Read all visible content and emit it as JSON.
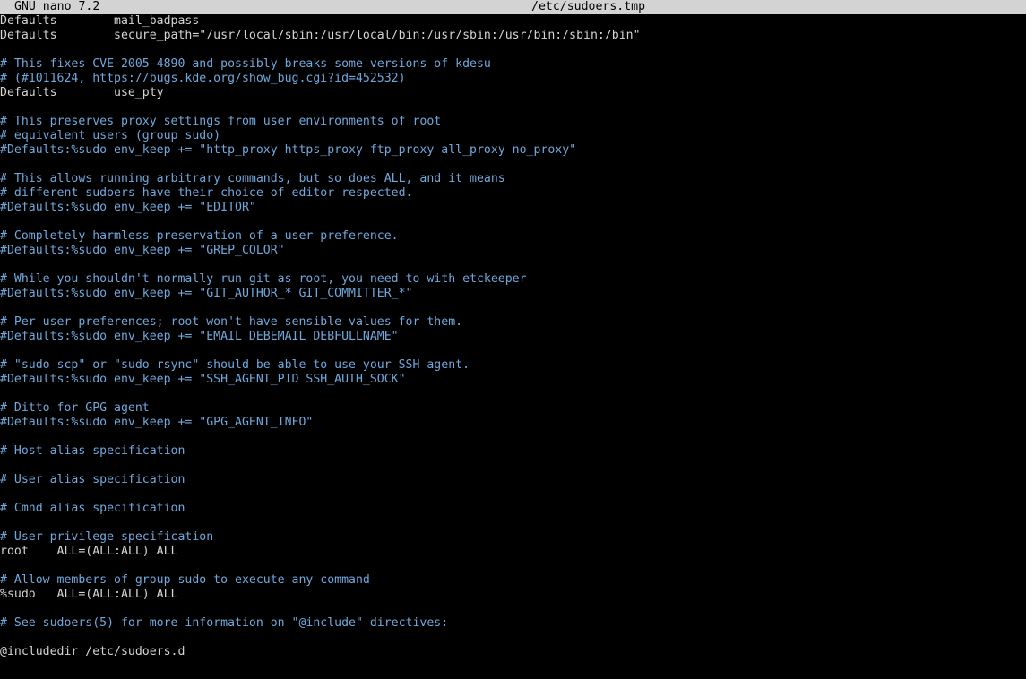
{
  "titlebar": {
    "app_name": "GNU nano 7.2",
    "file_name": "/etc/sudoers.tmp"
  },
  "colors": {
    "background": "#000000",
    "text": "#d3d3d3",
    "comment": "#6fa8dc",
    "titlebar_bg": "#d3d3d3"
  },
  "lines": [
    {
      "text": "Defaults        mail_badpass",
      "kind": "text"
    },
    {
      "text": "Defaults        secure_path=\"/usr/local/sbin:/usr/local/bin:/usr/sbin:/usr/bin:/sbin:/bin\"",
      "kind": "text"
    },
    {
      "text": "",
      "kind": "text"
    },
    {
      "text": "# This fixes CVE-2005-4890 and possibly breaks some versions of kdesu",
      "kind": "comment"
    },
    {
      "text": "# (#1011624, https://bugs.kde.org/show_bug.cgi?id=452532)",
      "kind": "comment"
    },
    {
      "text": "Defaults        use_pty",
      "kind": "text"
    },
    {
      "text": "",
      "kind": "text"
    },
    {
      "text": "# This preserves proxy settings from user environments of root",
      "kind": "comment"
    },
    {
      "text": "# equivalent users (group sudo)",
      "kind": "comment"
    },
    {
      "text": "#Defaults:%sudo env_keep += \"http_proxy https_proxy ftp_proxy all_proxy no_proxy\"",
      "kind": "comment"
    },
    {
      "text": "",
      "kind": "text"
    },
    {
      "text": "# This allows running arbitrary commands, but so does ALL, and it means",
      "kind": "comment"
    },
    {
      "text": "# different sudoers have their choice of editor respected.",
      "kind": "comment"
    },
    {
      "text": "#Defaults:%sudo env_keep += \"EDITOR\"",
      "kind": "comment"
    },
    {
      "text": "",
      "kind": "text"
    },
    {
      "text": "# Completely harmless preservation of a user preference.",
      "kind": "comment"
    },
    {
      "text": "#Defaults:%sudo env_keep += \"GREP_COLOR\"",
      "kind": "comment"
    },
    {
      "text": "",
      "kind": "text"
    },
    {
      "text": "# While you shouldn't normally run git as root, you need to with etckeeper",
      "kind": "comment"
    },
    {
      "text": "#Defaults:%sudo env_keep += \"GIT_AUTHOR_* GIT_COMMITTER_*\"",
      "kind": "comment"
    },
    {
      "text": "",
      "kind": "text"
    },
    {
      "text": "# Per-user preferences; root won't have sensible values for them.",
      "kind": "comment"
    },
    {
      "text": "#Defaults:%sudo env_keep += \"EMAIL DEBEMAIL DEBFULLNAME\"",
      "kind": "comment"
    },
    {
      "text": "",
      "kind": "text"
    },
    {
      "text": "# \"sudo scp\" or \"sudo rsync\" should be able to use your SSH agent.",
      "kind": "comment"
    },
    {
      "text": "#Defaults:%sudo env_keep += \"SSH_AGENT_PID SSH_AUTH_SOCK\"",
      "kind": "comment"
    },
    {
      "text": "",
      "kind": "text"
    },
    {
      "text": "# Ditto for GPG agent",
      "kind": "comment"
    },
    {
      "text": "#Defaults:%sudo env_keep += \"GPG_AGENT_INFO\"",
      "kind": "comment"
    },
    {
      "text": "",
      "kind": "text"
    },
    {
      "text": "# Host alias specification",
      "kind": "comment"
    },
    {
      "text": "",
      "kind": "text"
    },
    {
      "text": "# User alias specification",
      "kind": "comment"
    },
    {
      "text": "",
      "kind": "text"
    },
    {
      "text": "# Cmnd alias specification",
      "kind": "comment"
    },
    {
      "text": "",
      "kind": "text"
    },
    {
      "text": "# User privilege specification",
      "kind": "comment"
    },
    {
      "text": "root    ALL=(ALL:ALL) ALL",
      "kind": "text"
    },
    {
      "text": "",
      "kind": "text"
    },
    {
      "text": "# Allow members of group sudo to execute any command",
      "kind": "comment"
    },
    {
      "text": "%sudo   ALL=(ALL:ALL) ALL",
      "kind": "text"
    },
    {
      "text": "",
      "kind": "text"
    },
    {
      "text": "# See sudoers(5) for more information on \"@include\" directives:",
      "kind": "comment"
    },
    {
      "text": "",
      "kind": "text"
    },
    {
      "text": "@includedir /etc/sudoers.d",
      "kind": "text"
    }
  ]
}
